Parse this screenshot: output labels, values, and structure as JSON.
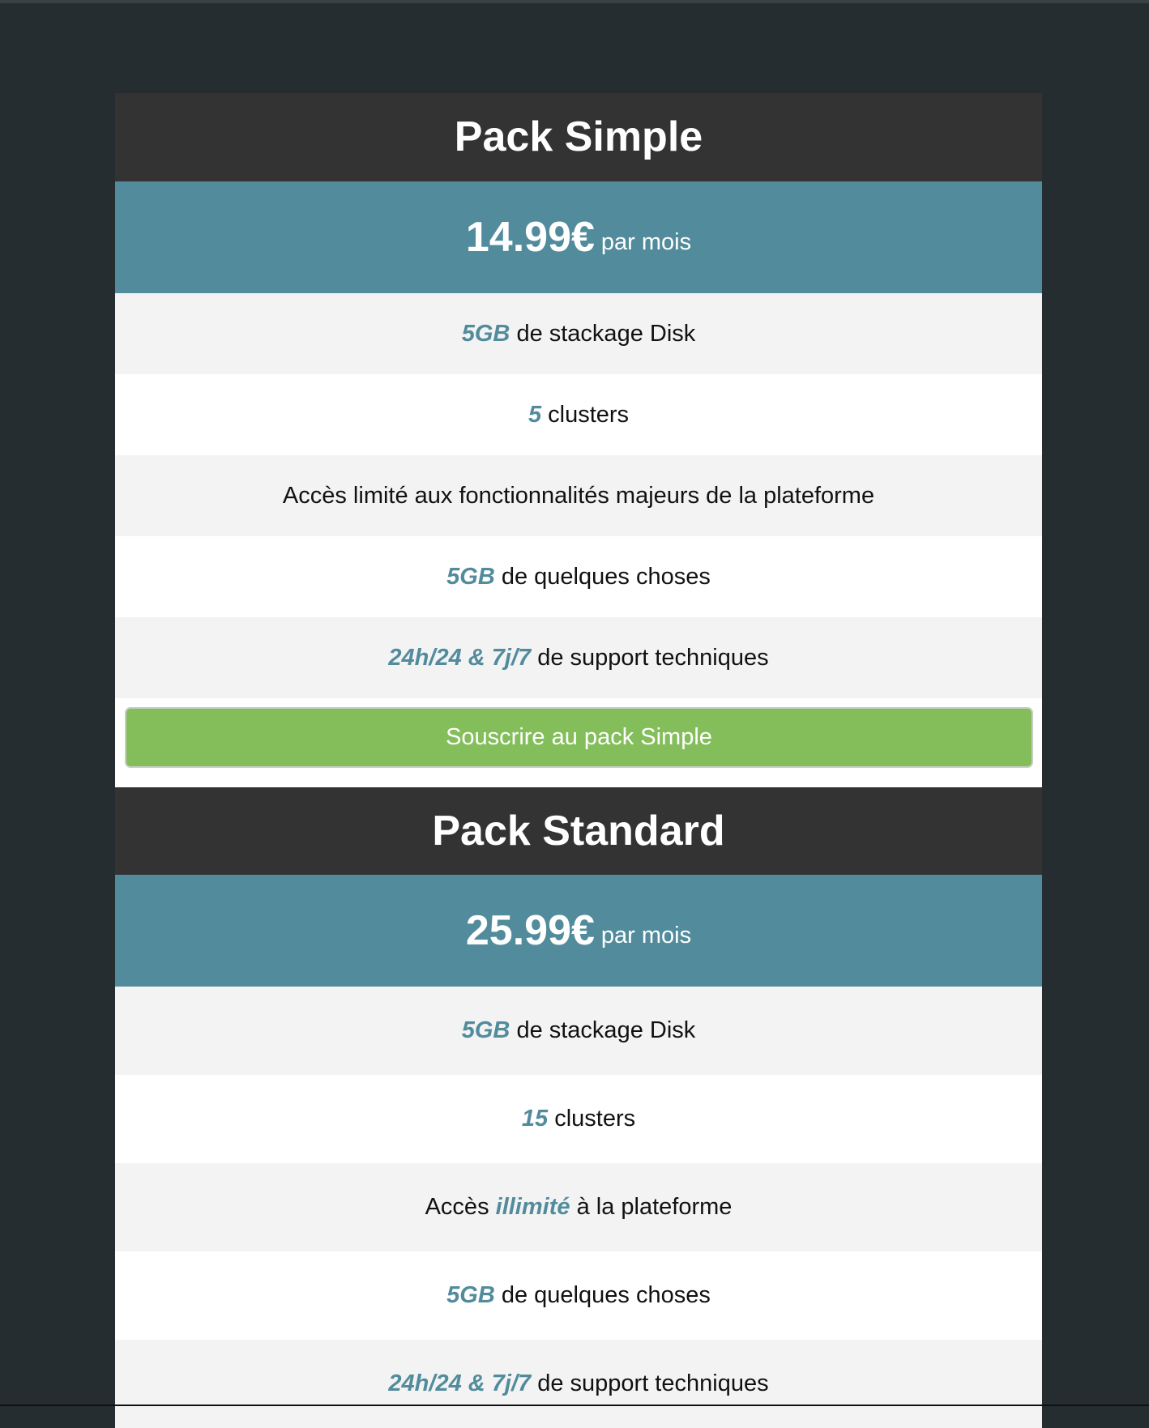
{
  "plans": [
    {
      "name": "Pack Simple",
      "price": "14.99€",
      "period": "par mois",
      "features": [
        {
          "hl": "5GB",
          "text": "de stackage Disk"
        },
        {
          "hl": "5",
          "text": "clusters"
        },
        {
          "text": "Accès limité aux fonctionnalités majeurs de la plateforme"
        },
        {
          "hl": "5GB",
          "text": "de quelques choses"
        },
        {
          "hl": "24h/24 & 7j/7",
          "text": "de support techniques"
        }
      ],
      "button_label": "Souscrire au pack Simple"
    },
    {
      "name": "Pack Standard",
      "price": "25.99€",
      "period": "par mois",
      "features": [
        {
          "hl": "5GB",
          "text": "de stackage Disk"
        },
        {
          "hl": "15",
          "text": "clusters"
        },
        {
          "pre": "Accès",
          "hl": "illimité",
          "text": "à la plateforme"
        },
        {
          "hl": "5GB",
          "text": "de quelques choses"
        },
        {
          "hl": "24h/24 & 7j/7",
          "text": "de support techniques"
        }
      ]
    }
  ],
  "colors": {
    "background": "#252d30",
    "header": "#333333",
    "accent": "#528c9c",
    "row_alt": "#f3f3f3",
    "button": "#84be5b"
  }
}
